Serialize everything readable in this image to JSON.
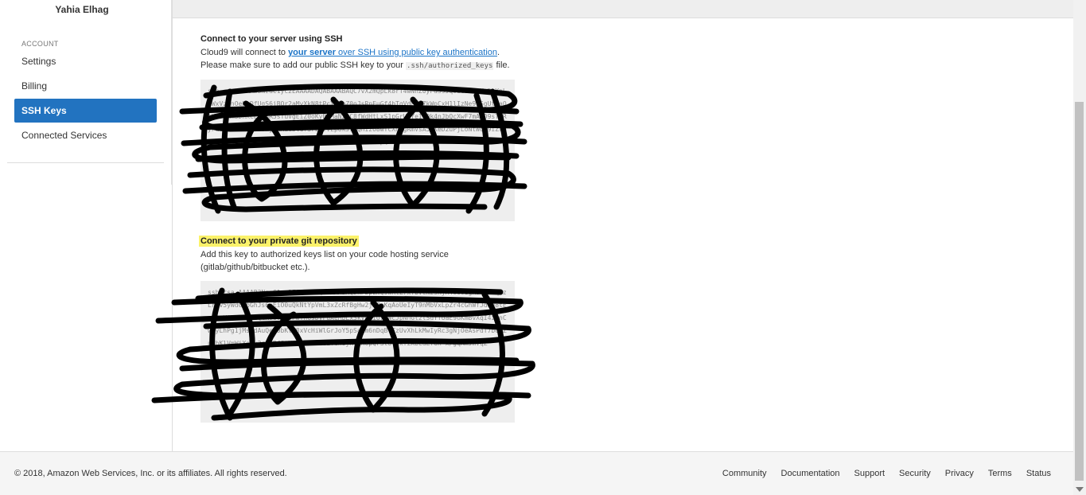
{
  "sidebar": {
    "username": "Yahia Elhag",
    "section_label": "ACCOUNT",
    "items": [
      {
        "label": "Settings"
      },
      {
        "label": "Billing"
      },
      {
        "label": "SSH Keys"
      },
      {
        "label": "Connected Services"
      }
    ]
  },
  "ssh": {
    "title": "Connect to your server using SSH",
    "line1_prefix": "Cloud9 will connect to ",
    "link_bold": "your server",
    "link_rest": " over SSH using public key authentication",
    "line1_suffix": ".",
    "line2_prefix": "Please make sure to add our public SSH key to your ",
    "line2_code": ".ssh/authorized_keys",
    "line2_suffix": " file."
  },
  "git": {
    "title": "Connect to your private git repository",
    "line1": "Add this key to authorized keys list on your code hosting service",
    "line2": "(gitlab/github/bitbucket etc.)."
  },
  "footer": {
    "copyright": "© 2018, Amazon Web Services, Inc. or its affiliates. All rights reserved.",
    "links": [
      "Community",
      "Documentation",
      "Support",
      "Security",
      "Privacy",
      "Terms",
      "Status"
    ]
  }
}
